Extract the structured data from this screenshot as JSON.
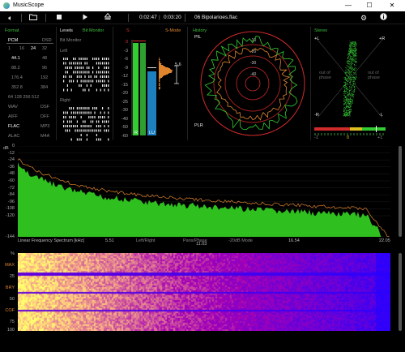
{
  "window": {
    "title": "MusicScope",
    "min": "—",
    "max": "☐",
    "close": "✕"
  },
  "toolbar": {
    "elapsed": "0:02:47",
    "total": "0:03:20",
    "track": "06 Bipolarioes.flac"
  },
  "colors": {
    "green": "#33cc33",
    "orange": "#e0852e",
    "blue": "#1e7fbf",
    "red": "#e03333"
  },
  "format": {
    "title": "Format",
    "headers": [
      "PCM",
      "DSD"
    ],
    "bits": [
      "1",
      "16",
      "24",
      "32"
    ],
    "rates": [
      [
        "44.1",
        "48"
      ],
      [
        "88.2",
        "96"
      ],
      [
        "176.4",
        "192"
      ],
      [
        "352.8",
        "384"
      ]
    ],
    "dsd_rates": "64 128 256 512",
    "types": [
      [
        "WAV",
        "DSF"
      ],
      [
        "AIFF",
        "DFF"
      ],
      [
        "FLAC",
        "MP3"
      ],
      [
        "ALAC",
        "M4A"
      ]
    ]
  },
  "levels": {
    "title": "Levels",
    "mode": "Bit Monitor",
    "subtitle": "Bit Monitor",
    "left": "Left",
    "right": "Right",
    "scale": [
      "0",
      "-3",
      "-6",
      "-9",
      "-12",
      "-15",
      "-20",
      "-25",
      "-30",
      "-40",
      "-50",
      "-60"
    ],
    "smode": "S-Mode",
    "labels": [
      "R",
      "LU"
    ],
    "peak_value": "5.6",
    "legend_s": "S"
  },
  "history": {
    "title": "History",
    "pil": "PIL",
    "plr": "PLR",
    "rings": [
      "-10",
      "-20",
      "-30",
      "-40"
    ]
  },
  "stereo": {
    "title": "Stereo",
    "plus_l": "+L",
    "plus_r": "+R",
    "minus_l": "-L",
    "minus_r": "-R",
    "oop_left": "out of phase",
    "oop_right": "out of phase",
    "corr_min": "-1",
    "corr_mid": "0",
    "corr_max": "+1"
  },
  "spectrum": {
    "unit": "dB",
    "yticks": [
      "0",
      "-12",
      "-24",
      "-36",
      "-48",
      "-60",
      "-72",
      "-84",
      "-96",
      "-108",
      "-120",
      "-144"
    ],
    "xticks": [
      "5.51",
      "11.03",
      "16.54",
      "22.05"
    ],
    "caption": "Linear Frequency Spectrum [kHz]",
    "mode1": "Left/Right",
    "mode2": "Pans/Phase",
    "mode3": "-20dB Mode"
  },
  "spectrogram": {
    "yticks": [
      "%",
      "MAX",
      "25",
      "BRY",
      "50",
      "COF",
      "75",
      "100"
    ]
  }
}
